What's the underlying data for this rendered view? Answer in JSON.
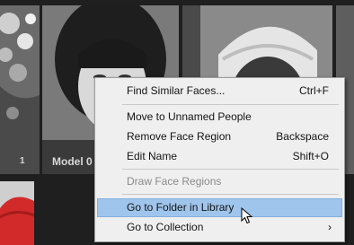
{
  "tiles": {
    "left_count": "1",
    "model_label": "Model 0"
  },
  "context_menu": {
    "find_similar": {
      "label": "Find Similar Faces...",
      "shortcut": "Ctrl+F"
    },
    "move_unnamed": {
      "label": "Move to Unnamed People"
    },
    "remove_region": {
      "label": "Remove Face Region",
      "shortcut": "Backspace"
    },
    "edit_name": {
      "label": "Edit Name",
      "shortcut": "Shift+O"
    },
    "draw_regions": {
      "label": "Draw Face Regions"
    },
    "go_to_folder": {
      "label": "Go to Folder in Library"
    },
    "go_to_collection": {
      "label": "Go to Collection"
    },
    "submenu_arrow": "›"
  },
  "colors": {
    "highlight": "#9fc5ec",
    "menu_background": "#efefef",
    "grid_background": "#1f1f1f"
  }
}
